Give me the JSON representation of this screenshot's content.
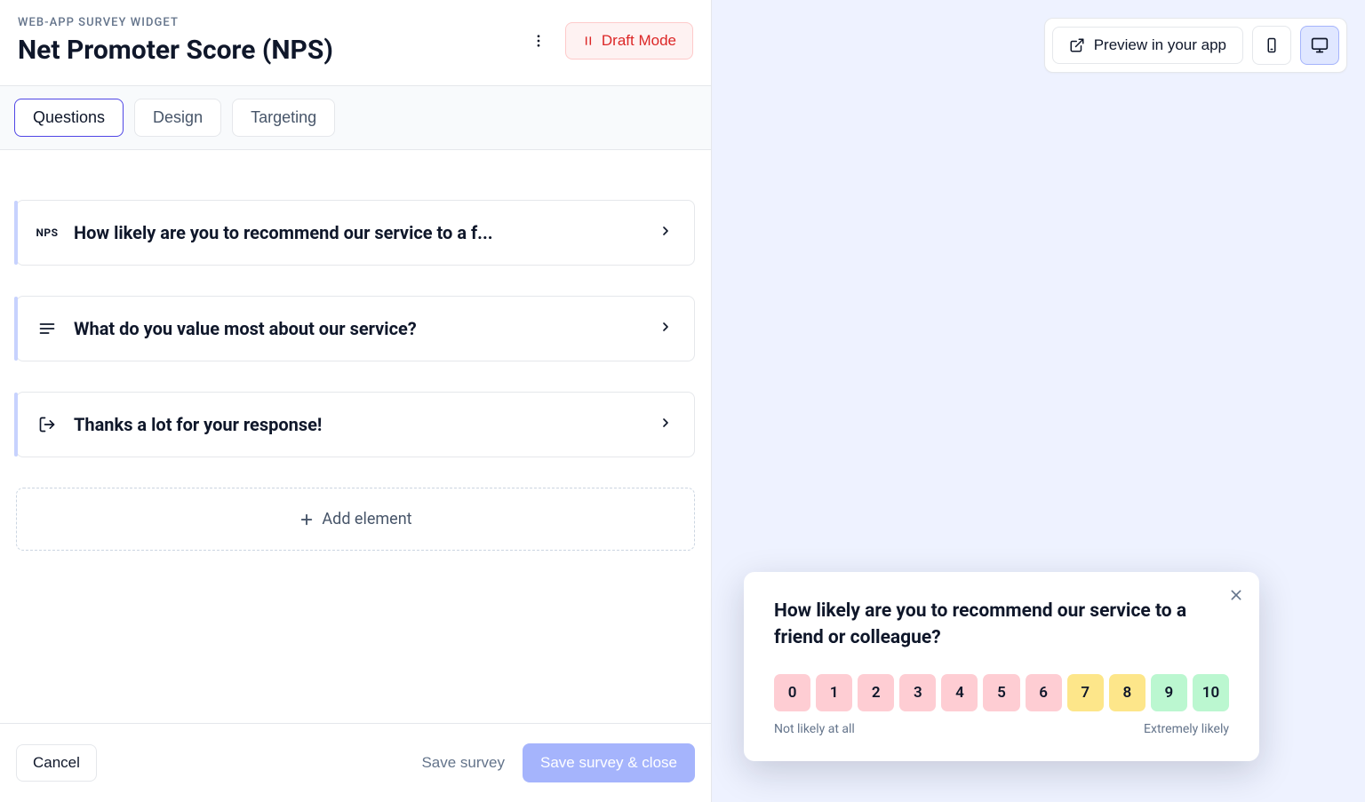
{
  "header": {
    "eyebrow": "WEB-APP SURVEY WIDGET",
    "title": "Net Promoter Score (NPS)",
    "draft_label": "Draft Mode"
  },
  "tabs": [
    {
      "label": "Questions",
      "active": true
    },
    {
      "label": "Design",
      "active": false
    },
    {
      "label": "Targeting",
      "active": false
    }
  ],
  "questions": [
    {
      "icon": "nps",
      "title": "How likely are you to recommend our service to a f..."
    },
    {
      "icon": "text",
      "title": "What do you value most about our service?"
    },
    {
      "icon": "exit",
      "title": "Thanks a lot for your response!"
    }
  ],
  "add_element_label": "Add element",
  "footer": {
    "cancel": "Cancel",
    "save": "Save survey",
    "save_close": "Save survey & close"
  },
  "preview": {
    "button": "Preview in your app"
  },
  "widget": {
    "question": "How likely are you to recommend our service to a friend or colleague?",
    "scale": [
      {
        "n": "0",
        "cls": "c-red"
      },
      {
        "n": "1",
        "cls": "c-red"
      },
      {
        "n": "2",
        "cls": "c-red"
      },
      {
        "n": "3",
        "cls": "c-red"
      },
      {
        "n": "4",
        "cls": "c-red"
      },
      {
        "n": "5",
        "cls": "c-red"
      },
      {
        "n": "6",
        "cls": "c-red"
      },
      {
        "n": "7",
        "cls": "c-org"
      },
      {
        "n": "8",
        "cls": "c-org"
      },
      {
        "n": "9",
        "cls": "c-grn"
      },
      {
        "n": "10",
        "cls": "c-grn"
      }
    ],
    "low_label": "Not likely at all",
    "high_label": "Extremely likely"
  }
}
